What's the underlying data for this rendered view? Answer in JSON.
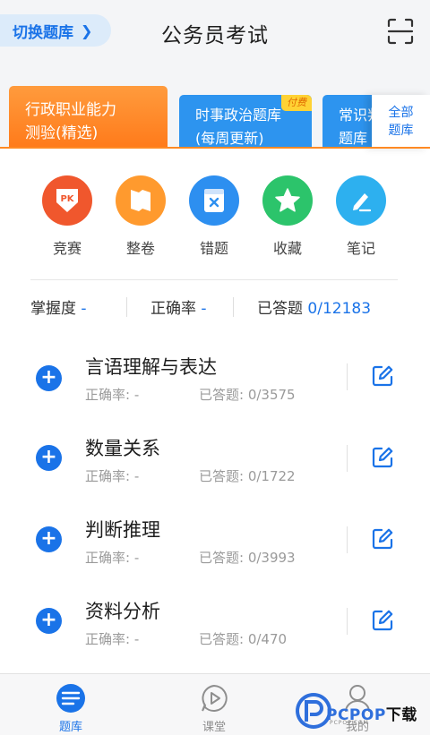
{
  "header": {
    "switch_label": "切换题库",
    "title": "公务员考试",
    "scan_icon": "scan-icon"
  },
  "categories": {
    "card1_line1": "行政职业能力",
    "card1_line2": "测验(精选)",
    "card2_line1": "时事政治题库",
    "card2_line2": "(每周更新)",
    "card2_badge": "付费",
    "card3_line1": "常识判",
    "card3_line2": "题库",
    "all_line1": "全部",
    "all_line2": "题库"
  },
  "quick": [
    {
      "label": "竞赛",
      "icon": "pk-icon",
      "color": "#f0572d"
    },
    {
      "label": "整卷",
      "icon": "paper-icon",
      "color": "#ff9a2e"
    },
    {
      "label": "错题",
      "icon": "wrong-icon",
      "color": "#2d8ff0"
    },
    {
      "label": "收藏",
      "icon": "star-icon",
      "color": "#2cc46b"
    },
    {
      "label": "笔记",
      "icon": "pen-icon",
      "color": "#2db0ef"
    }
  ],
  "stats": {
    "mastery_label": "掌握度",
    "mastery_value": "-",
    "accuracy_label": "正确率",
    "accuracy_value": "-",
    "answered_label": "已答题",
    "answered_value": "0/12183"
  },
  "list": [
    {
      "title": "言语理解与表达",
      "accuracy": "正确率: -",
      "answered": "已答题: 0/3575"
    },
    {
      "title": "数量关系",
      "accuracy": "正确率: -",
      "answered": "已答题: 0/1722"
    },
    {
      "title": "判断推理",
      "accuracy": "正确率: -",
      "answered": "已答题: 0/3993"
    },
    {
      "title": "资料分析",
      "accuracy": "正确率: -",
      "answered": "已答题: 0/470"
    }
  ],
  "tabs": [
    {
      "label": "题库",
      "icon": "question-bank-icon",
      "active": true
    },
    {
      "label": "课堂",
      "icon": "play-icon",
      "active": false
    },
    {
      "label": "我的",
      "icon": "user-icon",
      "active": false
    }
  ],
  "watermark": {
    "text": "PCPOP",
    "text_cn": "下载",
    "sub": "PCPOP.COM"
  },
  "colors": {
    "accent": "#1a73e8",
    "orange": "#ff8a24",
    "gray": "#9a9a9a"
  }
}
